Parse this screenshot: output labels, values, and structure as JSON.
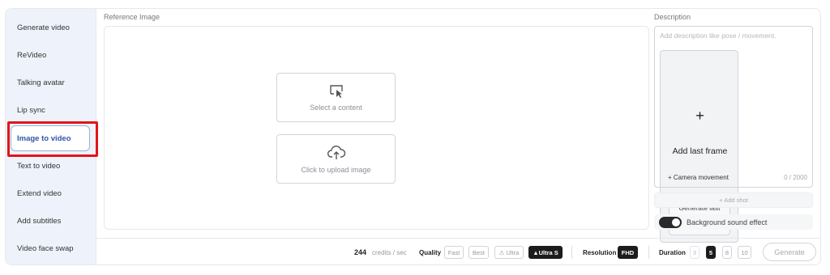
{
  "sidebar": {
    "items": [
      {
        "label": "Generate video"
      },
      {
        "label": "ReVideo"
      },
      {
        "label": "Talking avatar"
      },
      {
        "label": "Lip sync"
      },
      {
        "label": "Image to video",
        "active": true
      },
      {
        "label": "Text to video"
      },
      {
        "label": "Extend video"
      },
      {
        "label": "Add subtitles"
      },
      {
        "label": "Video face swap"
      }
    ]
  },
  "reference": {
    "label": "Reference Image",
    "select_content": "Select a content",
    "upload": "Click to upload image",
    "add_last_frame_icon": "+",
    "add_last_frame": "Add last frame",
    "generate_last_frame": "Generate last frame from first frame"
  },
  "description": {
    "label": "Description",
    "placeholder": "Add description like pose / movement.",
    "camera_movement": "+ Camera movement",
    "counter": "0 / 2000",
    "add_shot": "+ Add shot",
    "background_sound": "Background sound effect"
  },
  "bottom": {
    "credits_value": "244",
    "credits_unit": "credits / sec",
    "quality_label": "Quality",
    "quality_options": [
      "Fast",
      "Best",
      "⚠ Ultra",
      "▲Ultra S"
    ],
    "quality_selected": "▲Ultra S",
    "resolution_label": "Resolution",
    "resolution_value": "FHD",
    "duration_label": "Duration",
    "duration_options": [
      "3",
      "5",
      "8",
      "10"
    ],
    "duration_selected": "5",
    "generate": "Generate"
  },
  "icons": [
    "cursor-select-icon",
    "cloud-upload-icon",
    "plus-icon"
  ],
  "colors": {
    "sidebar_bg": "#eef3fb",
    "active_text": "#2f55a4",
    "highlight": "#e3141b",
    "dark": "#1c1c1c"
  }
}
